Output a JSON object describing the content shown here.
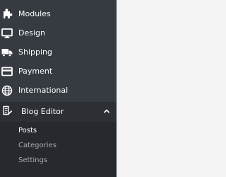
{
  "sidebar": {
    "items": [
      {
        "label": "Modules",
        "icon": "puzzle-piece-icon"
      },
      {
        "label": "Design",
        "icon": "desktop-monitor-icon"
      },
      {
        "label": "Shipping",
        "icon": "truck-icon"
      },
      {
        "label": "Payment",
        "icon": "credit-card-icon"
      },
      {
        "label": "International",
        "icon": "globe-icon"
      }
    ],
    "open_section": {
      "label": "Blog Editor",
      "icon": "document-icon",
      "expanded": true,
      "submenu": [
        {
          "label": "Posts",
          "active": true
        },
        {
          "label": "Categories",
          "active": false
        },
        {
          "label": "Settings",
          "active": false
        }
      ]
    }
  },
  "colors": {
    "sidebar_bg": "#363a41",
    "open_section_bg": "#2c2f34",
    "submenu_bg": "#262a2e",
    "active_text": "#ffffff",
    "inactive_text": "#a7abb1",
    "content_bg": "#f4f4f5"
  }
}
